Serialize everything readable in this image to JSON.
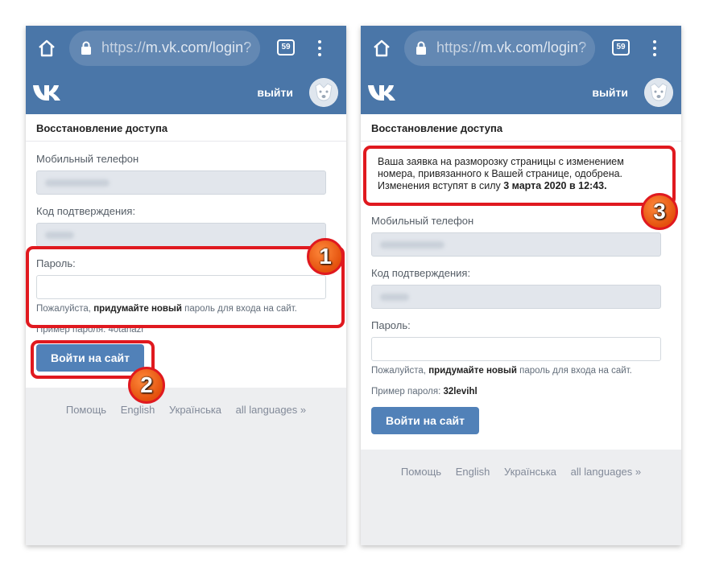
{
  "browser": {
    "url_scheme": "https://",
    "url_host": "m.vk.com/login?",
    "tab_count": "59"
  },
  "vk_header": {
    "logout_label": "выйти"
  },
  "page": {
    "title": "Восстановление доступа",
    "phone_label": "Мобильный телефон",
    "code_label": "Код подтверждения:",
    "password_label": "Пароль:",
    "hint_prefix": "Пожалуйста, ",
    "hint_bold": "придумайте новый",
    "hint_suffix": " пароль для входа на сайт.",
    "example_label_left": "Пример пароля: 40tanazi",
    "example_label": "Пример пароля: ",
    "example_value_right": "32levihl",
    "submit_label": "Войти на сайт"
  },
  "notice": {
    "text": "Ваша заявка на разморозку страницы с изменением номера, привязанного к Вашей странице, одобрена. Изменения вступят в силу ",
    "date": "3 марта 2020 в 12:43."
  },
  "footer": {
    "help": "Помощь",
    "english": "English",
    "ukrainian": "Українська",
    "all_languages": "all languages »"
  },
  "annotations": {
    "badge1": "1",
    "badge2": "2",
    "badge3": "3",
    "highlight_color": "#e0191f",
    "badge_color": "#e4510d"
  },
  "colors": {
    "vk_blue": "#4a76a8",
    "button_blue": "#5181b8",
    "page_bg": "#edeef0"
  }
}
